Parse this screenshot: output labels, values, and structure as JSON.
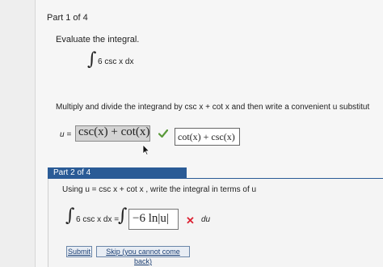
{
  "part1": {
    "heading": "Part 1 of 4",
    "instruction": "Evaluate the integral.",
    "integral_sign": "∫",
    "integrand": "6 csc x dx",
    "multiply_instruction": "Multiply and divide the integrand by  csc x + cot x  and then write a convenient u substitut",
    "u_label": "u =",
    "student_answer": "csc(x) + cot(x)",
    "correct_answer": "cot(x) + csc(x)"
  },
  "part2": {
    "heading": "Part 2 of 4",
    "instruction": "Using  u = csc x + cot x , write the integral in terms of u",
    "integral_sign": "∫",
    "integrand": "6 csc x dx =",
    "integral_sign_2": "∫",
    "student_answer": "−6 ln|u|",
    "wrong_mark": "✕",
    "differential": "du"
  },
  "buttons": {
    "submit": "Submit",
    "skip": "Skip (you cannot come back)"
  },
  "colors": {
    "part_header": "#2a5b96",
    "check": "#5a9a3a",
    "wrong": "#dd2233"
  }
}
